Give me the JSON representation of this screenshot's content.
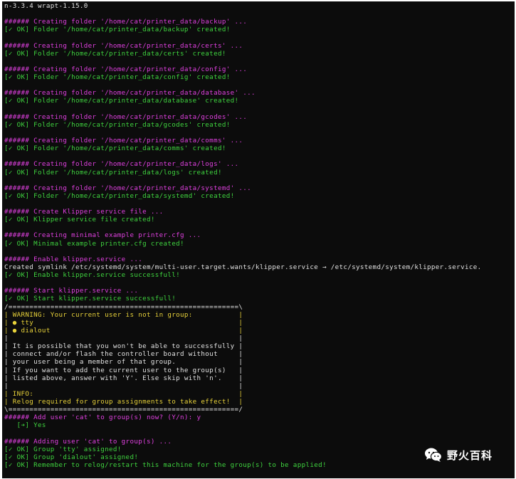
{
  "terminal": {
    "lines": [
      {
        "t": "n-3.3.4 wrapt-1.15.0",
        "c": "w"
      },
      {
        "t": "",
        "c": "w"
      },
      {
        "t": "###### Creating folder '/home/cat/printer_data/backup' ...",
        "c": "m"
      },
      {
        "t": "[✓ OK] Folder '/home/cat/printer_data/backup' created!",
        "c": "g"
      },
      {
        "t": "",
        "c": "w"
      },
      {
        "t": "###### Creating folder '/home/cat/printer_data/certs' ...",
        "c": "m"
      },
      {
        "t": "[✓ OK] Folder '/home/cat/printer_data/certs' created!",
        "c": "g"
      },
      {
        "t": "",
        "c": "w"
      },
      {
        "t": "###### Creating folder '/home/cat/printer_data/config' ...",
        "c": "m"
      },
      {
        "t": "[✓ OK] Folder '/home/cat/printer_data/config' created!",
        "c": "g"
      },
      {
        "t": "",
        "c": "w"
      },
      {
        "t": "###### Creating folder '/home/cat/printer_data/database' ...",
        "c": "m"
      },
      {
        "t": "[✓ OK] Folder '/home/cat/printer_data/database' created!",
        "c": "g"
      },
      {
        "t": "",
        "c": "w"
      },
      {
        "t": "###### Creating folder '/home/cat/printer_data/gcodes' ...",
        "c": "m"
      },
      {
        "t": "[✓ OK] Folder '/home/cat/printer_data/gcodes' created!",
        "c": "g"
      },
      {
        "t": "",
        "c": "w"
      },
      {
        "t": "###### Creating folder '/home/cat/printer_data/comms' ...",
        "c": "m"
      },
      {
        "t": "[✓ OK] Folder '/home/cat/printer_data/comms' created!",
        "c": "g"
      },
      {
        "t": "",
        "c": "w"
      },
      {
        "t": "###### Creating folder '/home/cat/printer_data/logs' ...",
        "c": "m"
      },
      {
        "t": "[✓ OK] Folder '/home/cat/printer_data/logs' created!",
        "c": "g"
      },
      {
        "t": "",
        "c": "w"
      },
      {
        "t": "###### Creating folder '/home/cat/printer_data/systemd' ...",
        "c": "m"
      },
      {
        "t": "[✓ OK] Folder '/home/cat/printer_data/systemd' created!",
        "c": "g"
      },
      {
        "t": "",
        "c": "w"
      },
      {
        "t": "###### Create Klipper service file ...",
        "c": "m"
      },
      {
        "t": "[✓ OK] Klipper service file created!",
        "c": "g"
      },
      {
        "t": "",
        "c": "w"
      },
      {
        "t": "###### Creating minimal example printer.cfg ...",
        "c": "m"
      },
      {
        "t": "[✓ OK] Minimal example printer.cfg created!",
        "c": "g"
      },
      {
        "t": "",
        "c": "w"
      },
      {
        "t": "###### Enable klipper.service ...",
        "c": "m"
      },
      {
        "t": "Created symlink /etc/systemd/system/multi-user.target.wants/klipper.service → /etc/systemd/system/klipper.service.",
        "c": "w"
      },
      {
        "t": "[✓ OK] Enable klipper.service successfull!",
        "c": "g"
      },
      {
        "t": "",
        "c": "w"
      },
      {
        "t": "###### Start klipper.service ...",
        "c": "m"
      },
      {
        "t": "[✓ OK] Start klipper.service successfull!",
        "c": "g"
      },
      {
        "t": "/=======================================================\\",
        "c": "w"
      },
      {
        "t": "| WARNING: Your current user is not in group:           |",
        "c": "y"
      },
      {
        "t": "| ● tty                                                 |",
        "c": "y"
      },
      {
        "t": "| ● dialout                                             |",
        "c": "y"
      },
      {
        "t": "|                                                       |",
        "c": "w"
      },
      {
        "t": "| It is possible that you won't be able to successfully |",
        "c": "w"
      },
      {
        "t": "| connect and/or flash the controller board without     |",
        "c": "w"
      },
      {
        "t": "| your user being a member of that group.               |",
        "c": "w"
      },
      {
        "t": "| If you want to add the current user to the group(s)   |",
        "c": "w"
      },
      {
        "t": "| listed above, answer with 'Y'. Else skip with 'n'.    |",
        "c": "w"
      },
      {
        "t": "|                                                       |",
        "c": "w"
      },
      {
        "t": "| INFO:                                                 |",
        "c": "y"
      },
      {
        "t": "| Relog required for group assignments to take effect!  |",
        "c": "y"
      },
      {
        "t": "\\=======================================================/",
        "c": "w"
      },
      {
        "t": "###### Add user 'cat' to group(s) now? (Y/n): y",
        "c": "m"
      },
      {
        "t": "   [➔] Yes",
        "c": "g"
      },
      {
        "t": "",
        "c": "w"
      },
      {
        "t": "###### Adding user 'cat' to group(s) ...",
        "c": "m"
      },
      {
        "t": "[✓ OK] Group 'tty' assigned!",
        "c": "g"
      },
      {
        "t": "[✓ OK] Group 'dialout' assigned!",
        "c": "g"
      },
      {
        "t": "[✓ OK] Remember to relog/restart this machine for the group(s) to be applied!",
        "c": "g"
      }
    ]
  },
  "watermark": {
    "icon": "wechat-icon",
    "text": "野火百科"
  }
}
